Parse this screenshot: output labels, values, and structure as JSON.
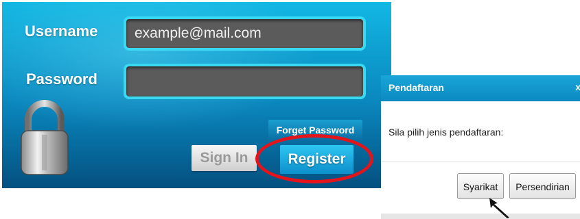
{
  "login": {
    "username_label": "Username",
    "password_label": "Password",
    "username_value": "example@mail.com",
    "password_value": "",
    "forget_password_label": "Forget Password",
    "signin_label": "Sign In",
    "register_label": "Register",
    "lock_icon": "padlock-icon"
  },
  "dialog": {
    "title": "Pendaftaran",
    "close_label": "x",
    "message": "Sila pilih jenis pendaftaran:",
    "syarikat_label": "Syarikat",
    "persendirian_label": "Persendirian"
  },
  "annotations": {
    "highlight_color": "#e4141b",
    "cursor_icon": "arrow-cursor-icon"
  },
  "colors": {
    "panel_top": "#12b7e3",
    "panel_bottom": "#04507f",
    "field_border": "#39d9f4",
    "dialog_header": "#1aa5d8"
  }
}
